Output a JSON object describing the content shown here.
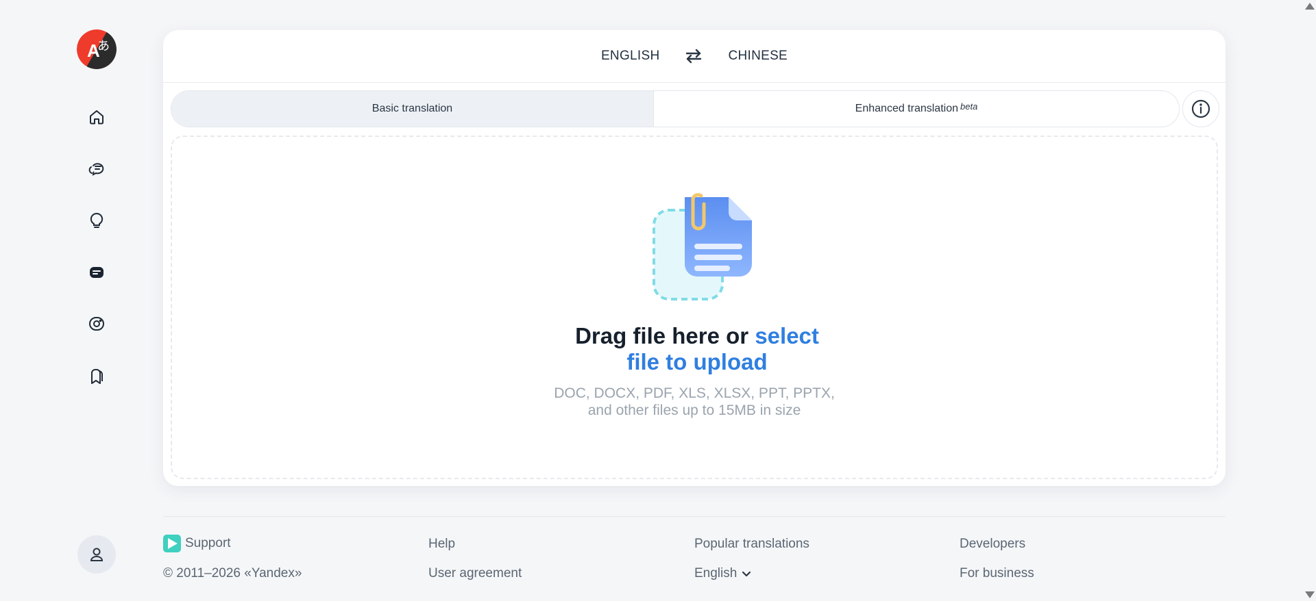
{
  "languages": {
    "source": "ENGLISH",
    "target": "CHINESE"
  },
  "tabs": [
    {
      "label": "Basic translation",
      "badge": ""
    },
    {
      "label": "Enhanced translation",
      "badge": "beta"
    }
  ],
  "dropzone": {
    "title_prefix": "Drag file here or ",
    "title_link": "select file to upload",
    "hint_line1": "DOC, DOCX, PDF, XLS, XLSX, PPT, PPTX,",
    "hint_line2": "and other files up to 15MB in size"
  },
  "footer": {
    "support": "Support",
    "copyright": "© 2011–2026 «Yandex»",
    "help": "Help",
    "user_agreement": "User agreement",
    "popular_translations": "Popular translations",
    "language_selector": "English",
    "developers": "Developers",
    "for_business": "For business"
  },
  "icons": {
    "logo": "translate-logo-icon",
    "nav": [
      "home-icon",
      "chat-icon",
      "lightbulb-icon",
      "document-icon",
      "camera-icon",
      "bookmark-icon"
    ],
    "swap": "swap-icon",
    "info": "info-icon",
    "user": "user-icon"
  },
  "colors": {
    "accent": "#2f7fe0",
    "logo_red": "#ee3b2b",
    "logo_dark": "#2b2b2b"
  }
}
